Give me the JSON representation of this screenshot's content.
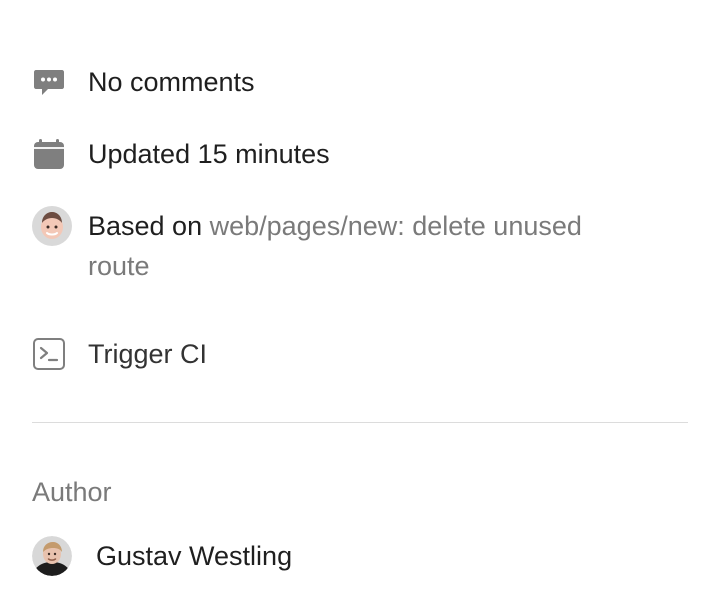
{
  "info": {
    "comments": {
      "icon": "comment-icon",
      "label": "No comments"
    },
    "updated": {
      "icon": "calendar-icon",
      "label": "Updated 15 minutes"
    },
    "based_on": {
      "icon": "avatar-icon",
      "prefix": "Based on",
      "link_text": "web/pages/new: delete unused route"
    },
    "trigger": {
      "icon": "terminal-icon",
      "label": "Trigger CI"
    }
  },
  "author_section": {
    "heading": "Author",
    "name": "Gustav Westling",
    "avatar_icon": "user-avatar"
  },
  "colors": {
    "text": "#1f1f1f",
    "muted": "#7a7a7a",
    "icon": "#7f7f7f",
    "divider": "#dcdcdc"
  }
}
